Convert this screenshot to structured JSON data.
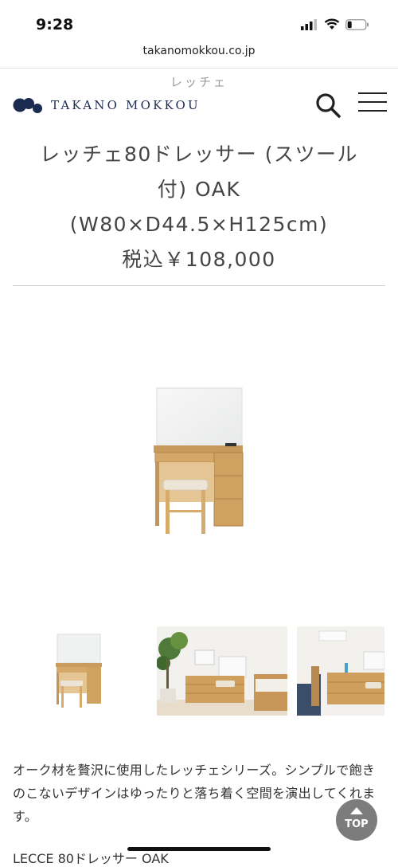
{
  "status_bar": {
    "time": "9:28"
  },
  "browser": {
    "url": "takanomokkou.co.jp"
  },
  "header": {
    "sub_label": "レッチェ",
    "logo_text": "TAKANO MOKKOU",
    "brand_color": "#1b2b4f",
    "search_icon": "search-icon",
    "menu_icon": "hamburger-menu-icon"
  },
  "product": {
    "name_line1": "レッチェ80ドレッサー (スツール",
    "name_line2": "付) OAK",
    "name_line3": "(W80×D44.5×H125cm)",
    "price": "税込￥108,000"
  },
  "gallery": {
    "main_image": "dresser-with-stool-photo",
    "thumbnails": [
      "dresser-thumbnail",
      "room-with-plant-thumbnail",
      "bedroom-thumbnail"
    ]
  },
  "description": "オーク材を贅沢に使用したレッチェシリーズ。シンプルで飽きのこないデザインはゆったりと落ち着く空間を演出してくれます。",
  "next_title": "LECCE 80ドレッサー OAK",
  "top_button": {
    "label": "TOP",
    "icon": "arrow-up-icon"
  }
}
